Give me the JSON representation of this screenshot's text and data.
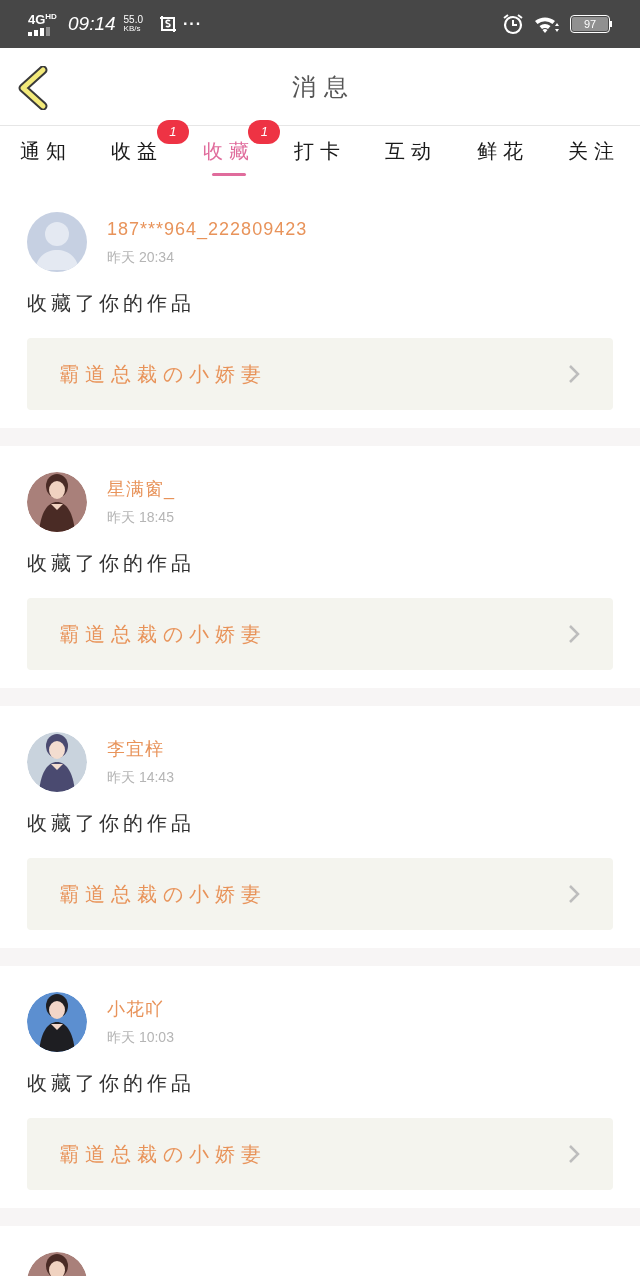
{
  "status_bar": {
    "network": "4G",
    "network_sub": "HD",
    "time": "09:14",
    "speed": "55.0",
    "speed_unit": "KB/s",
    "more": "···",
    "battery": "97"
  },
  "header": {
    "title": "消息"
  },
  "tabs": [
    {
      "label": "通知",
      "selected": false
    },
    {
      "label": "收益",
      "selected": false,
      "badge": "1"
    },
    {
      "label": "收藏",
      "selected": true,
      "badge": "1"
    },
    {
      "label": "打卡",
      "selected": false
    },
    {
      "label": "互动",
      "selected": false
    },
    {
      "label": "鲜花",
      "selected": false
    },
    {
      "label": "关注",
      "selected": false
    }
  ],
  "messages": [
    {
      "avatar": {
        "kind": "default"
      },
      "user": "187***964_222809423",
      "time": "昨天 20:34",
      "text": "收藏了你的作品",
      "work": "霸道总裁の小娇妻"
    },
    {
      "avatar": {
        "kind": "picture"
      },
      "user": "星满窗_",
      "time": "昨天 18:45",
      "text": "收藏了你的作品",
      "work": "霸道总裁の小娇妻"
    },
    {
      "avatar": {
        "kind": "picture"
      },
      "user": "李宜梓",
      "time": "昨天 14:43",
      "text": "收藏了你的作品",
      "work": "霸道总裁の小娇妻"
    },
    {
      "avatar": {
        "kind": "picture"
      },
      "user": "小花吖",
      "time": "昨天 10:03",
      "text": "收藏了你的作品",
      "work": "霸道总裁の小娇妻"
    },
    {
      "avatar": {
        "kind": "picture"
      }
    }
  ]
}
